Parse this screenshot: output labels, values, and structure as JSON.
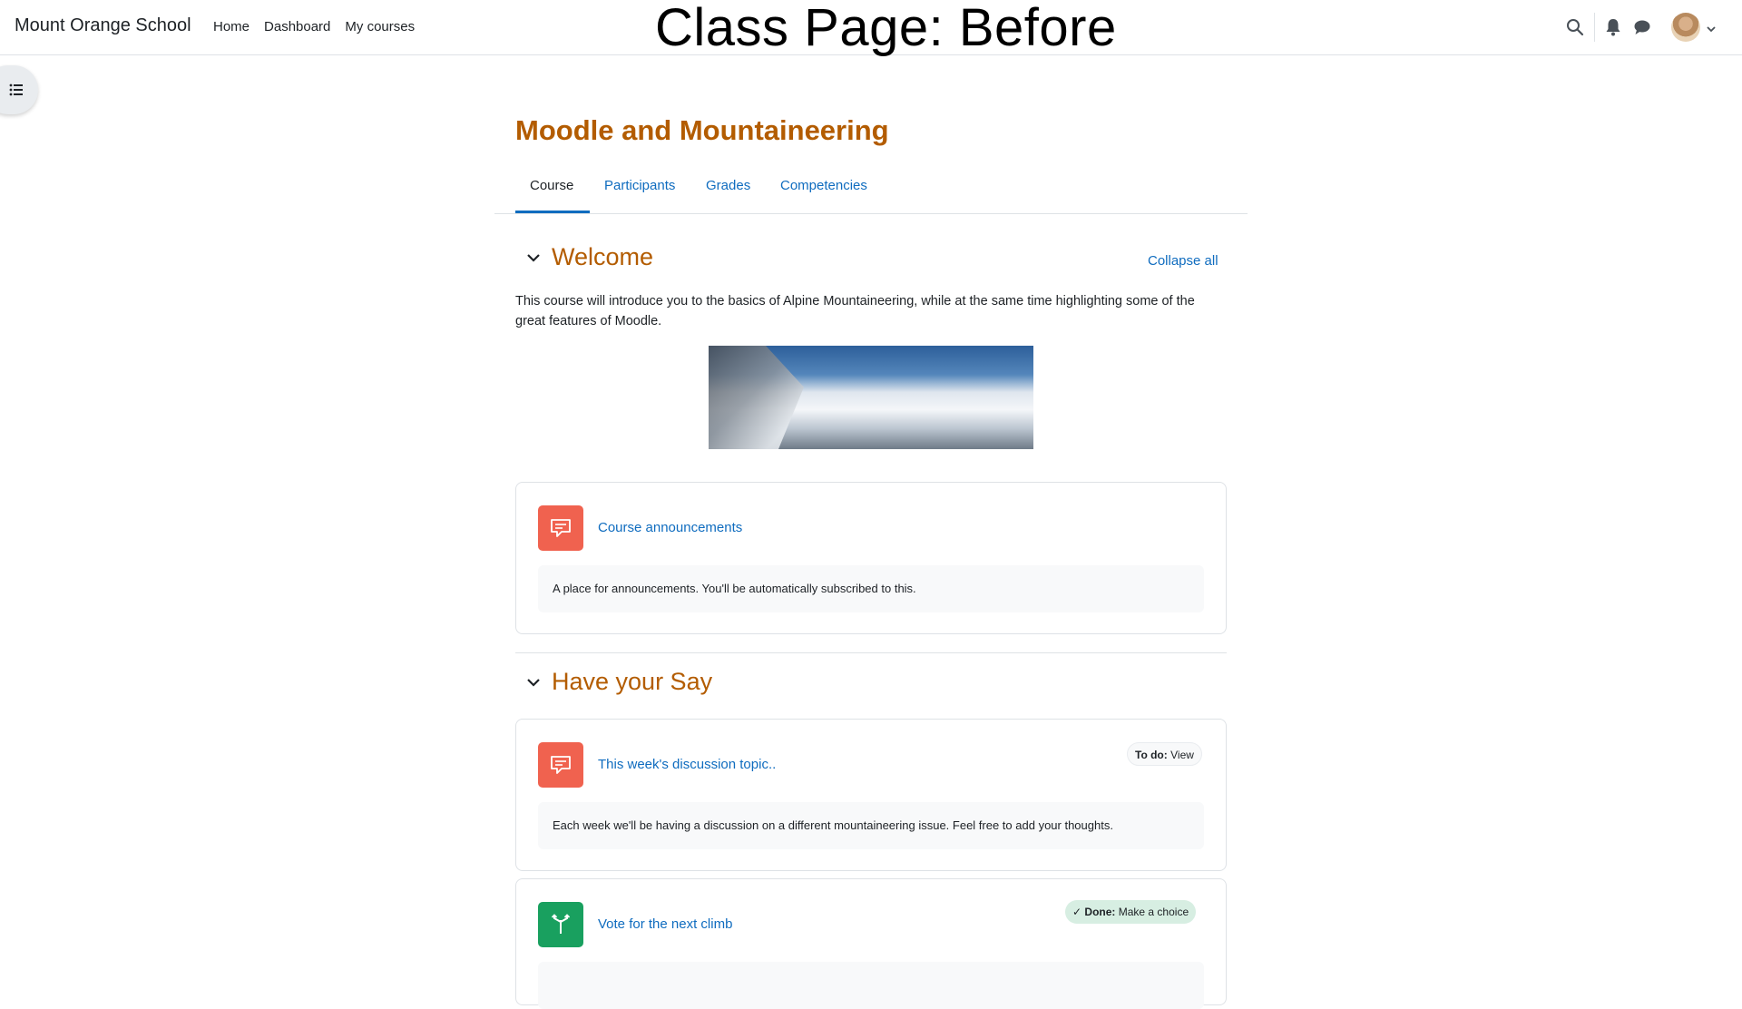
{
  "navbar": {
    "brand": "Mount Orange School",
    "links": [
      "Home",
      "Dashboard",
      "My courses"
    ],
    "overlay_title": "Class Page: Before"
  },
  "course": {
    "title": "Moodle and Mountaineering",
    "tabs": [
      "Course",
      "Participants",
      "Grades",
      "Competencies"
    ],
    "active_tab": "Course"
  },
  "sections": [
    {
      "title": "Welcome",
      "collapse_label": "Collapse all",
      "intro": "This course will introduce you to the basics of Alpine Mountaineering, while at the same time highlighting some of the great features of Moodle.",
      "activities": [
        {
          "name": "Course announcements",
          "icon": "forum-icon",
          "description": "A place for announcements. You'll be automatically subscribed to this."
        }
      ]
    },
    {
      "title": "Have your Say",
      "activities": [
        {
          "name": "This week's discussion topic..",
          "icon": "forum-icon",
          "badge_strong": "To do:",
          "badge_text": "View",
          "description": "Each week we'll be having a discussion on a different mountaineering issue. Feel free to add your thoughts."
        },
        {
          "name": "Vote for the next climb",
          "icon": "choice-icon",
          "badge_strong": "Done:",
          "badge_text": "Make a choice"
        }
      ]
    }
  ],
  "colors": {
    "accent": "#0f6cbf",
    "section_title": "#b35c00",
    "forum_icon_bg": "#f0624f",
    "choice_icon_bg": "#19a05f"
  }
}
